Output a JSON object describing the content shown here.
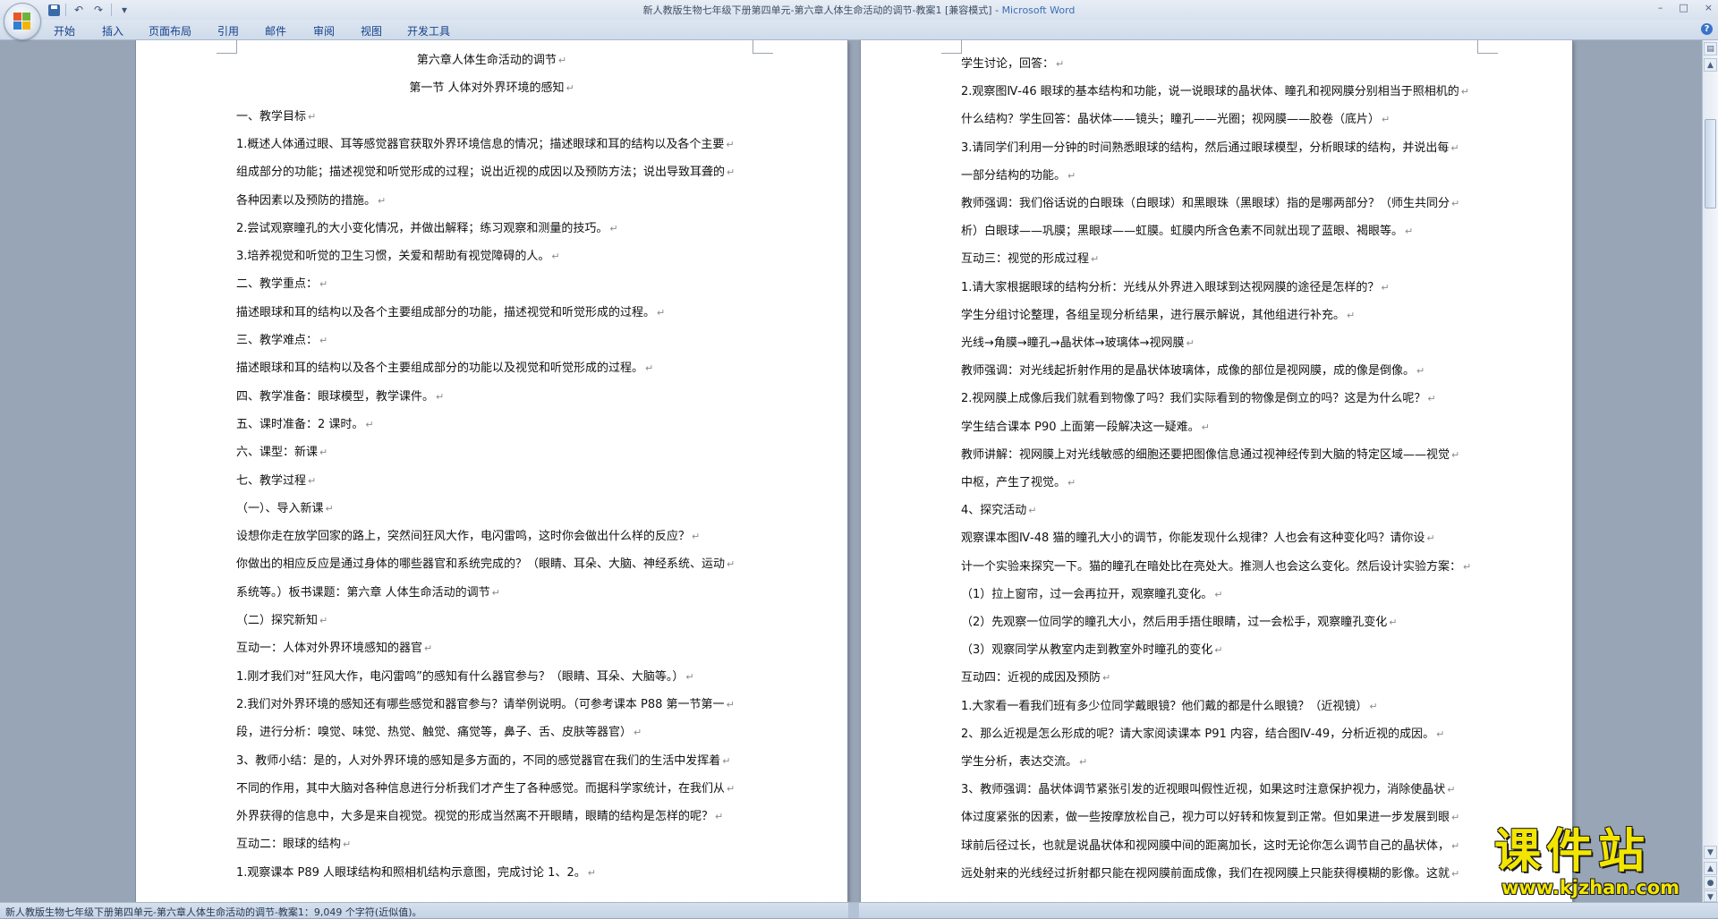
{
  "window": {
    "title": "新人教版生物七年级下册第四单元-第六章人体生命活动的调节-教案1 [兼容模式] - ",
    "app_name": "Microsoft Word",
    "controls": [
      "–",
      "□",
      "×"
    ]
  },
  "quick_access": {
    "icons": [
      "save-icon",
      "undo-icon",
      "redo-icon",
      "customize-icon"
    ],
    "undo_glyph": "↶",
    "redo_glyph": "↷",
    "more_glyph": "▾"
  },
  "ribbon": {
    "tabs": [
      "开始",
      "插入",
      "页面布局",
      "引用",
      "邮件",
      "审阅",
      "视图",
      "开发工具"
    ],
    "help_glyph": "?"
  },
  "document": {
    "paragraph_mark": "↵",
    "left_page": [
      {
        "text": "第六章人体生命活动的调节",
        "center": true
      },
      {
        "text": "第一节  人体对外界环境的感知",
        "center": true
      },
      {
        "text": "一、教学目标"
      },
      {
        "text": "1.概述人体通过眼、耳等感觉器官获取外界环境信息的情况；描述眼球和耳的结构以及各个主要"
      },
      {
        "text": "组成部分的功能；描述视觉和听觉形成的过程；说出近视的成因以及预防方法；说出导致耳聋的"
      },
      {
        "text": "各种因素以及预防的措施。"
      },
      {
        "text": "2.尝试观察瞳孔的大小变化情况，并做出解释；练习观察和测量的技巧。"
      },
      {
        "text": "3.培养视觉和听觉的卫生习惯，关爱和帮助有视觉障碍的人。"
      },
      {
        "text": "二、教学重点："
      },
      {
        "text": "   描述眼球和耳的结构以及各个主要组成部分的功能，描述视觉和听觉形成的过程。"
      },
      {
        "text": "三、教学难点："
      },
      {
        "text": "   描述眼球和耳的结构以及各个主要组成部分的功能以及视觉和听觉形成的过程。"
      },
      {
        "text": "四、教学准备：眼球模型，教学课件。"
      },
      {
        "text": "五、课时准备：2 课时。"
      },
      {
        "text": "六、课型：新课"
      },
      {
        "text": "七、教学过程"
      },
      {
        "text": "（一）、导入新课"
      },
      {
        "text": "        设想你走在放学回家的路上，突然间狂风大作，电闪雷鸣，这时你会做出什么样的反应？"
      },
      {
        "text": "你做出的相应反应是通过身体的哪些器官和系统完成的？（眼睛、耳朵、大脑、神经系统、运动"
      },
      {
        "text": "系统等。）板书课题：第六章    人体生命活动的调节"
      },
      {
        "text": "（二）探究新知"
      },
      {
        "text": "互动一：人体对外界环境感知的器官"
      },
      {
        "text": "1.刚才我们对“狂风大作，电闪雷鸣”的感知有什么器官参与？（眼睛、耳朵、大脑等。）"
      },
      {
        "text": "2.我们对外界环境的感知还有哪些感觉和器官参与？请举例说明。（可参考课本  P88  第一节第一"
      },
      {
        "text": "段，进行分析：嗅觉、味觉、热觉、触觉、痛觉等，鼻子、舌、皮肤等器官）"
      },
      {
        "text": "3、教师小结：是的，人对外界环境的感知是多方面的，不同的感觉器官在我们的生活中发挥着"
      },
      {
        "text": "不同的作用，其中大脑对各种信息进行分析我们才产生了各种感觉。而据科学家统计，在我们从"
      },
      {
        "text": "外界获得的信息中，大多是来自视觉。视觉的形成当然离不开眼睛，眼睛的结构是怎样的呢？"
      },
      {
        "text": "互动二：眼球的结构"
      },
      {
        "text": "1.观察课本 P89 人眼球结构和照相机结构示意图，完成讨论 1、2。"
      }
    ],
    "right_page": [
      {
        "text": "学生讨论，回答："
      },
      {
        "text": "2.观察图Ⅳ-46 眼球的基本结构和功能，说一说眼球的晶状体、瞳孔和视网膜分别相当于照相机的"
      },
      {
        "text": "什么结构？学生回答：晶状体——镜头；瞳孔——光圈；视网膜——胶卷（底片）"
      },
      {
        "text": "3.请同学们利用一分钟的时间熟悉眼球的结构，然后通过眼球模型，分析眼球的结构，并说出每"
      },
      {
        "text": "一部分结构的功能。"
      },
      {
        "text": "教师强调：我们俗话说的白眼珠（白眼球）和黑眼珠（黑眼球）指的是哪两部分？（师生共同分"
      },
      {
        "text": "析）白眼球——巩膜；黑眼球——虹膜。虹膜内所含色素不同就出现了蓝眼、褐眼等。"
      },
      {
        "text": "互动三：视觉的形成过程"
      },
      {
        "text": "1.请大家根据眼球的结构分析：光线从外界进入眼球到达视网膜的途径是怎样的？"
      },
      {
        "text": "学生分组讨论整理，各组呈现分析结果，进行展示解说，其他组进行补充。"
      },
      {
        "text": "光线→角膜→瞳孔→晶状体→玻璃体→视网膜"
      },
      {
        "text": "教师强调：对光线起折射作用的是晶状体玻璃体，成像的部位是视网膜，成的像是倒像。"
      },
      {
        "text": "2.视网膜上成像后我们就看到物像了吗？我们实际看到的物像是倒立的吗？这是为什么呢？"
      },
      {
        "text": "学生结合课本 P90 上面第一段解决这一疑难。"
      },
      {
        "text": "教师讲解：视网膜上对光线敏感的细胞还要把图像信息通过视神经传到大脑的特定区域——视觉"
      },
      {
        "text": "中枢，产生了视觉。"
      },
      {
        "text": "4、探究活动"
      },
      {
        "text": "      观察课本图Ⅳ-48 猫的瞳孔大小的调节，你能发现什么规律？人也会有这种变化吗？请你设"
      },
      {
        "text": "计一个实验来探究一下。猫的瞳孔在暗处比在亮处大。推测人也会这么变化。然后设计实验方案："
      },
      {
        "text": "  （1）拉上窗帘，过一会再拉开，观察瞳孔变化。"
      },
      {
        "text": "  （2）先观察一位同学的瞳孔大小，然后用手捂住眼睛，过一会松手，观察瞳孔变化"
      },
      {
        "text": "  （3）观察同学从教室内走到教室外时瞳孔的变化"
      },
      {
        "text": "互动四：近视的成因及预防"
      },
      {
        "text": "1.大家看一看我们班有多少位同学戴眼镜？他们戴的都是什么眼镜？（近视镜）"
      },
      {
        "text": "2、那么近视是怎么形成的呢？请大家阅读课本 P91 内容，结合图Ⅳ-49，分析近视的成因。"
      },
      {
        "text": "学生分析，表达交流。"
      },
      {
        "text": "3、教师强调：晶状体调节紧张引发的近视眼叫假性近视，如果这时注意保护视力，消除使晶状"
      },
      {
        "text": "体过度紧张的因素，做一些按摩放松自己，视力可以好转和恢复到正常。但如果进一步发展到眼"
      },
      {
        "text": "球前后径过长，也就是说晶状体和视网膜中间的距离加长，这时无论你怎么调节自己的晶状体，"
      },
      {
        "text": "远处射来的光线经过折射都只能在视网膜前面成像，我们在视网膜上只能获得模糊的影像。这就"
      }
    ]
  },
  "status_bar": {
    "text": "新人教版生物七年级下册第四单元-第六章人体生命活动的调节-教案1：9,049 个字符(近似值)。"
  },
  "watermark": {
    "chinese": "课件站",
    "url": "www.kjzhan.com"
  }
}
